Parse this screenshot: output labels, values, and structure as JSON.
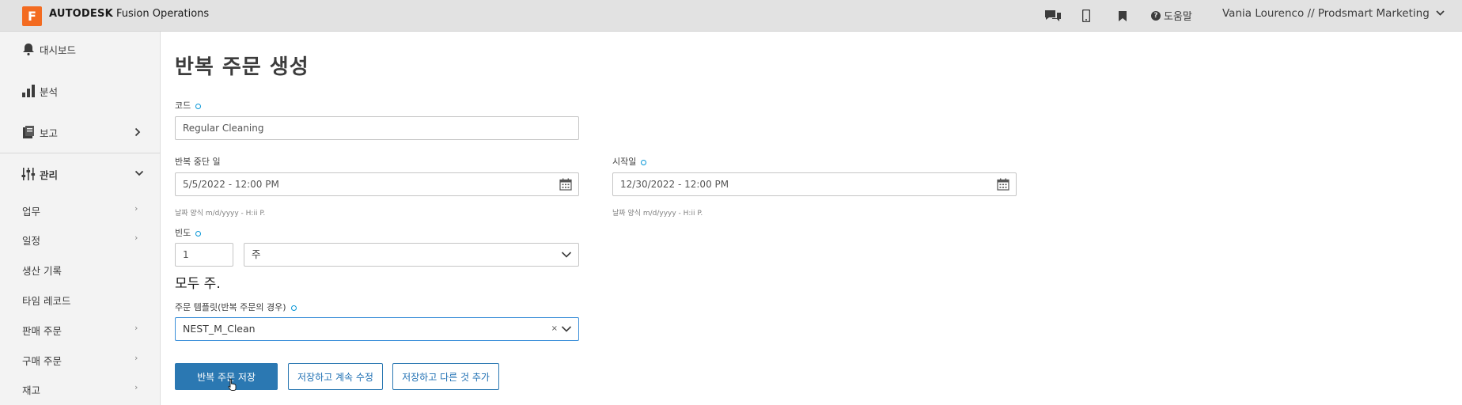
{
  "header": {
    "logo_letter": "F",
    "brand_bold": "AUTODESK",
    "brand_rest": " Fusion Operations",
    "help_label": "도움말",
    "user_label": "Vania Lourenco // Prodsmart Marketing",
    "icons": [
      "chat-icon",
      "mobile-icon",
      "bookmark-icon",
      "help-icon",
      "chevron-down-icon"
    ]
  },
  "sidebar": {
    "items": [
      {
        "label": "대시보드",
        "icon": "bell-icon"
      },
      {
        "label": "분석",
        "icon": "bar-chart-icon"
      },
      {
        "label": "보고",
        "icon": "report-icon",
        "chevron": "›"
      },
      {
        "label": "관리",
        "icon": "sliders-icon",
        "chevron": "⌄"
      }
    ],
    "subitems": [
      {
        "label": "업무",
        "chevron": "›"
      },
      {
        "label": "일정",
        "chevron": "›"
      },
      {
        "label": "생산 기록"
      },
      {
        "label": "타임 레코드"
      },
      {
        "label": "판매 주문",
        "chevron": "›"
      },
      {
        "label": "구매 주문",
        "chevron": "›"
      },
      {
        "label": "재고",
        "chevron": "›"
      }
    ]
  },
  "form": {
    "title": "반복 주문 생성",
    "code_label": "코드",
    "code_value": "Regular Cleaning",
    "end_label": "반복 중단 일",
    "end_value": "5/5/2022 - 12:00 PM",
    "start_label": "시작일",
    "start_value": "12/30/2022 - 12:00 PM",
    "date_hint": "날짜 양식 m/d/yyyy - H:ii P.",
    "freq_label": "빈도",
    "freq_value": "1",
    "freq_unit": "주",
    "every_text": "모두 주.",
    "template_label": "주문 템플릿(반복 주문의 경우)",
    "template_value": "NEST_M_Clean",
    "clear_symbol": "×"
  },
  "buttons": {
    "save": "반복 주문 저장",
    "save_continue": "저장하고 계속 수정",
    "save_add": "저장하고 다른 것 추가"
  },
  "colors": {
    "accent": "#2b78b2",
    "brand": "#f36b21",
    "required": "#0696d7"
  }
}
